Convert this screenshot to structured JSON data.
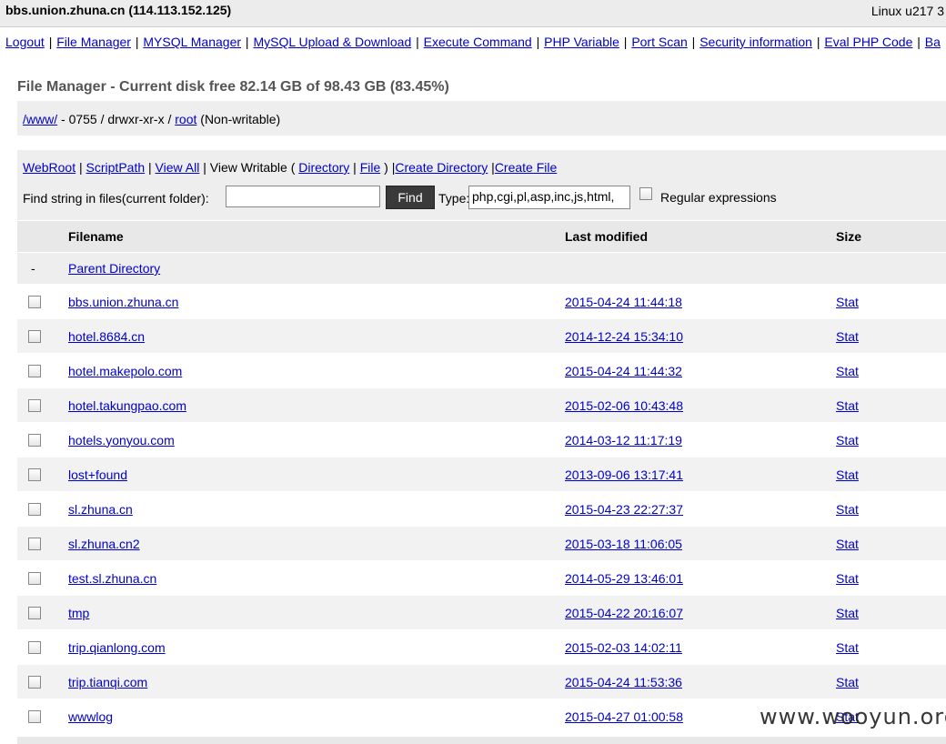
{
  "header": {
    "host": "bbs.union.zhuna.cn (114.113.152.125)",
    "sys_info": "Linux u217 3"
  },
  "nav": [
    "Logout",
    "File Manager",
    "MYSQL Manager",
    "MySQL Upload & Download",
    "Execute Command",
    "PHP Variable",
    "Port Scan",
    "Security information",
    "Eval PHP Code",
    "Ba"
  ],
  "file_manager": {
    "title": "File Manager - Current disk free 82.14 GB of 98.43 GB (83.45%)",
    "path": {
      "dir_link": "/www/",
      "perms": " - 0755 / drwxr-xr-x / ",
      "owner_link": "root",
      "writable": " (Non-writable)"
    },
    "tools": {
      "webroot": "WebRoot",
      "scriptpath": "ScriptPath",
      "view_all": "View All",
      "view_writable": "View Writable (",
      "directory": "Directory",
      "file": "File",
      "close_paren": ")",
      "create_dir": "Create Directory",
      "create_file": "Create File"
    },
    "search": {
      "label": "Find string in files(current folder):",
      "value": "",
      "button": "Find",
      "type_label": "Type:",
      "type_value": "php,cgi,pl,asp,inc,js,html,",
      "regex_label": "Regular expressions"
    },
    "columns": [
      "Filename",
      "Last modified",
      "Size"
    ],
    "parent": {
      "dash": "-",
      "label": "Parent Directory"
    },
    "rows": [
      {
        "name": "bbs.union.zhuna.cn",
        "modified": "2015-04-24 11:44:18",
        "size": "Stat"
      },
      {
        "name": "hotel.8684.cn",
        "modified": "2014-12-24 15:34:10",
        "size": "Stat"
      },
      {
        "name": "hotel.makepolo.com",
        "modified": "2015-04-24 11:44:32",
        "size": "Stat"
      },
      {
        "name": "hotel.takungpao.com",
        "modified": "2015-02-06 10:43:48",
        "size": "Stat"
      },
      {
        "name": "hotels.yonyou.com",
        "modified": "2014-03-12 11:17:19",
        "size": "Stat"
      },
      {
        "name": "lost+found",
        "modified": "2013-09-06 13:17:41",
        "size": "Stat"
      },
      {
        "name": "sl.zhuna.cn",
        "modified": "2015-04-23 22:27:37",
        "size": "Stat"
      },
      {
        "name": "sl.zhuna.cn2",
        "modified": "2015-03-18 11:06:05",
        "size": "Stat"
      },
      {
        "name": "test.sl.zhuna.cn",
        "modified": "2014-05-29 13:46:01",
        "size": "Stat"
      },
      {
        "name": "tmp",
        "modified": "2015-04-22 20:16:07",
        "size": "Stat"
      },
      {
        "name": "trip.qianlong.com",
        "modified": "2015-02-03 14:02:11",
        "size": "Stat"
      },
      {
        "name": "trip.tianqi.com",
        "modified": "2015-04-24 11:53:36",
        "size": "Stat"
      },
      {
        "name": "wwwlog",
        "modified": "2015-04-27 01:00:58",
        "size": "Stat"
      }
    ]
  },
  "watermark": "www.wooyun.org"
}
